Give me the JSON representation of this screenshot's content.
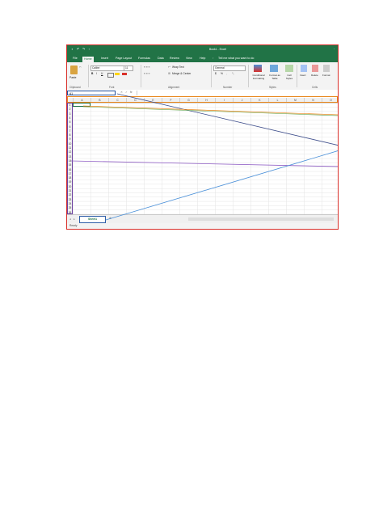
{
  "window": {
    "title": "Book1 - Excel",
    "tell_me": "Tell me what you want to do"
  },
  "ribbon_tabs": [
    "File",
    "Home",
    "Insert",
    "Page Layout",
    "Formulas",
    "Data",
    "Review",
    "View",
    "Help"
  ],
  "ribbon": {
    "clipboard": {
      "paste": "Paste",
      "label": "Clipboard"
    },
    "font": {
      "name": "Calibri",
      "size": "11",
      "label": "Font",
      "bold": "B",
      "italic": "I",
      "underline": "U"
    },
    "alignment": {
      "wrap": "Wrap Text",
      "merge": "Merge & Center",
      "label": "Alignment"
    },
    "number": {
      "format": "General",
      "currency": "$",
      "percent": "%",
      "label": "Number"
    },
    "styles": {
      "conditional": "Conditional Formatting",
      "format_table": "Format as Table",
      "cell_styles": "Cell Styles",
      "label": "Styles"
    },
    "cells": {
      "insert": "Insert",
      "delete": "Delete",
      "format": "Format",
      "label": "Cells"
    }
  },
  "formula_bar": {
    "name_box": "A1",
    "fx": "fx"
  },
  "columns": [
    "A",
    "B",
    "C",
    "D",
    "E",
    "F",
    "G",
    "H",
    "I",
    "J",
    "K",
    "L",
    "M",
    "N",
    "O",
    "P"
  ],
  "rows": [
    "1",
    "2",
    "3",
    "4",
    "5",
    "6",
    "7",
    "8",
    "9",
    "10",
    "11",
    "12",
    "13",
    "14",
    "15",
    "16",
    "17",
    "18",
    "19",
    "20",
    "21",
    "22",
    "23",
    "24",
    "25",
    "26"
  ],
  "sheet_tab": "Sheet1",
  "status": "Ready",
  "colors": {
    "excel_green": "#217346",
    "outline_red": "#d9302a",
    "name_box_blue": "#1f4e9c",
    "column_header_orange": "#e8861a",
    "row_header_purple": "#6b3fa0",
    "sheet_tab_blue": "#2f5ea8"
  }
}
